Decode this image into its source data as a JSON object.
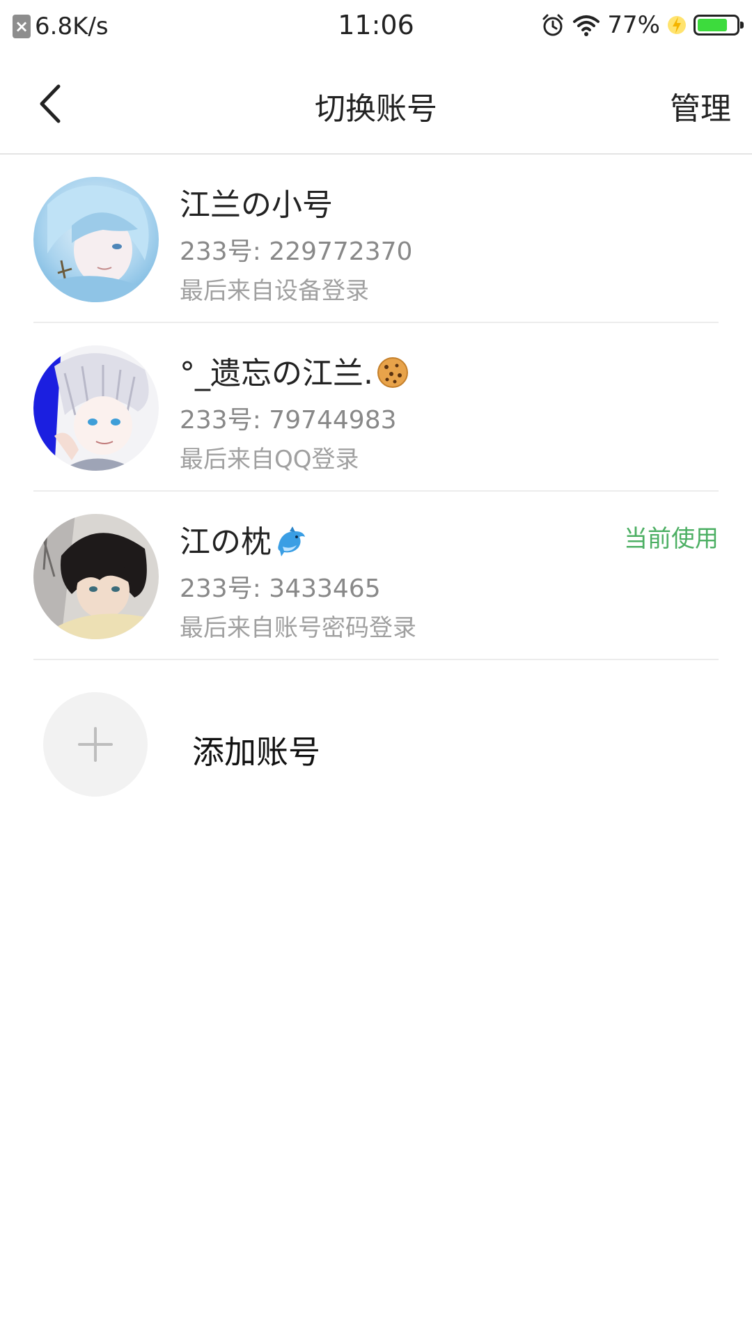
{
  "status_bar": {
    "speed": "6.8K/s",
    "time": "11:06",
    "battery_percent": "77%",
    "battery_level": 0.77
  },
  "header": {
    "title": "切换账号",
    "manage_label": "管理"
  },
  "accounts": [
    {
      "name": "江兰の小号",
      "id_text": "233号: 229772370",
      "login_text": "最后来自设备登录",
      "current_label": ""
    },
    {
      "name": "°_遗忘の江兰.",
      "name_emoji": "cookie-icon",
      "id_text": "233号: 79744983",
      "login_text": "最后来自QQ登录",
      "current_label": ""
    },
    {
      "name": "江の枕",
      "name_emoji": "dolphin-icon",
      "id_text": "233号: 3433465",
      "login_text": "最后来自账号密码登录",
      "current_label": "当前使用"
    }
  ],
  "add_account": {
    "label": "添加账号"
  },
  "colors": {
    "accent_green": "#4caf63",
    "battery_green": "#3ddb3d",
    "divider": "#ececec"
  }
}
